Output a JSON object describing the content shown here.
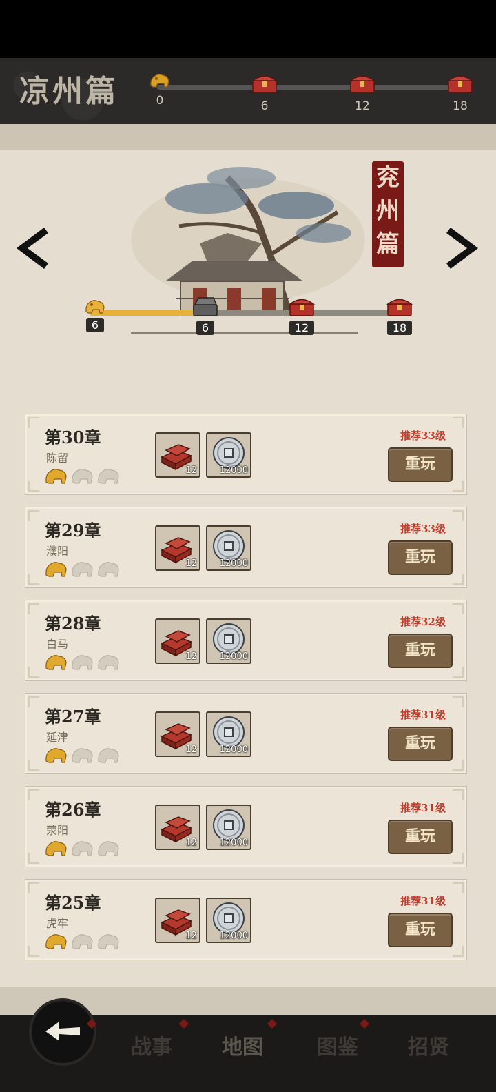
{
  "header": {
    "title": "凉州篇",
    "milestones": [
      {
        "type": "lion",
        "count": "0"
      },
      {
        "type": "chest",
        "count": "6"
      },
      {
        "type": "chest",
        "count": "12"
      },
      {
        "type": "chest",
        "count": "18"
      }
    ]
  },
  "chapter_region": {
    "title": "兖州篇",
    "progress": {
      "current": 6,
      "max": 18
    },
    "milestones": [
      {
        "type": "lion",
        "count": "6"
      },
      {
        "type": "chest-open",
        "count": "6"
      },
      {
        "type": "chest",
        "count": "12"
      },
      {
        "type": "chest",
        "count": "18"
      }
    ]
  },
  "chapters": [
    {
      "title": "第30章",
      "place": "陈留",
      "rec": "推荐33级",
      "stars": 1,
      "item1": "12",
      "item2": "12000",
      "button": "重玩"
    },
    {
      "title": "第29章",
      "place": "濮阳",
      "rec": "推荐33级",
      "stars": 1,
      "item1": "12",
      "item2": "12000",
      "button": "重玩"
    },
    {
      "title": "第28章",
      "place": "白马",
      "rec": "推荐32级",
      "stars": 1,
      "item1": "12",
      "item2": "12000",
      "button": "重玩"
    },
    {
      "title": "第27章",
      "place": "延津",
      "rec": "推荐31级",
      "stars": 1,
      "item1": "12",
      "item2": "12000",
      "button": "重玩"
    },
    {
      "title": "第26章",
      "place": "荥阳",
      "rec": "推荐31级",
      "stars": 1,
      "item1": "12",
      "item2": "12000",
      "button": "重玩"
    },
    {
      "title": "第25章",
      "place": "虎牢",
      "rec": "推荐31级",
      "stars": 1,
      "item1": "12",
      "item2": "12000",
      "button": "重玩"
    }
  ],
  "nav": {
    "back_icon": "back-arrow-icon",
    "tabs": [
      "战事",
      "地图",
      "图鉴",
      "招贤"
    ],
    "active": "地图"
  },
  "colors": {
    "accent_red": "#c53b2c",
    "gold": "#e8b23a",
    "button": "#7a6144"
  }
}
